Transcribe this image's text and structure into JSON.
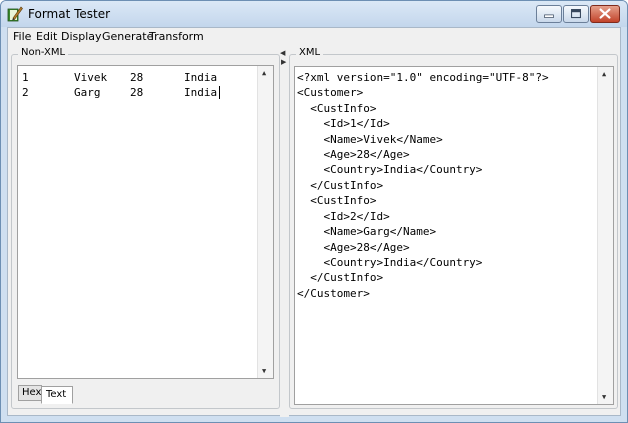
{
  "window": {
    "title": "Format Tester"
  },
  "menu": [
    "File",
    "Edit",
    "Display",
    "Generate",
    "Transform"
  ],
  "left_panel": {
    "label": "Non-XML",
    "rows": [
      {
        "id": "1",
        "name": "Vivek",
        "age": "28",
        "country": "India"
      },
      {
        "id": "2",
        "name": "Garg",
        "age": "28",
        "country": "India"
      }
    ],
    "tabs": [
      {
        "label": "Hex",
        "active": false
      },
      {
        "label": "Text",
        "active": true
      }
    ]
  },
  "right_panel": {
    "label": "XML",
    "lines": [
      "<?xml version=\"1.0\" encoding=\"UTF-8\"?>",
      "<Customer>",
      "  <CustInfo>",
      "    <Id>1</Id>",
      "    <Name>Vivek</Name>",
      "    <Age>28</Age>",
      "    <Country>India</Country>",
      "  </CustInfo>",
      "  <CustInfo>",
      "    <Id>2</Id>",
      "    <Name>Garg</Name>",
      "    <Age>28</Age>",
      "    <Country>India</Country>",
      "  </CustInfo>",
      "</Customer>"
    ]
  },
  "icons": {
    "app": "pen-book-icon",
    "minimize": "minimize-icon",
    "maximize": "maximize-icon",
    "close": "close-icon",
    "scroll_up": "scroll-up-arrow-icon",
    "scroll_down": "scroll-down-arrow-icon",
    "splitter_left": "splitter-collapse-left-icon",
    "splitter_right": "splitter-collapse-right-icon"
  },
  "colors": {
    "titlebar": "#c3d6ec",
    "close_button": "#c2432a",
    "window_border": "#6d8fb3"
  }
}
